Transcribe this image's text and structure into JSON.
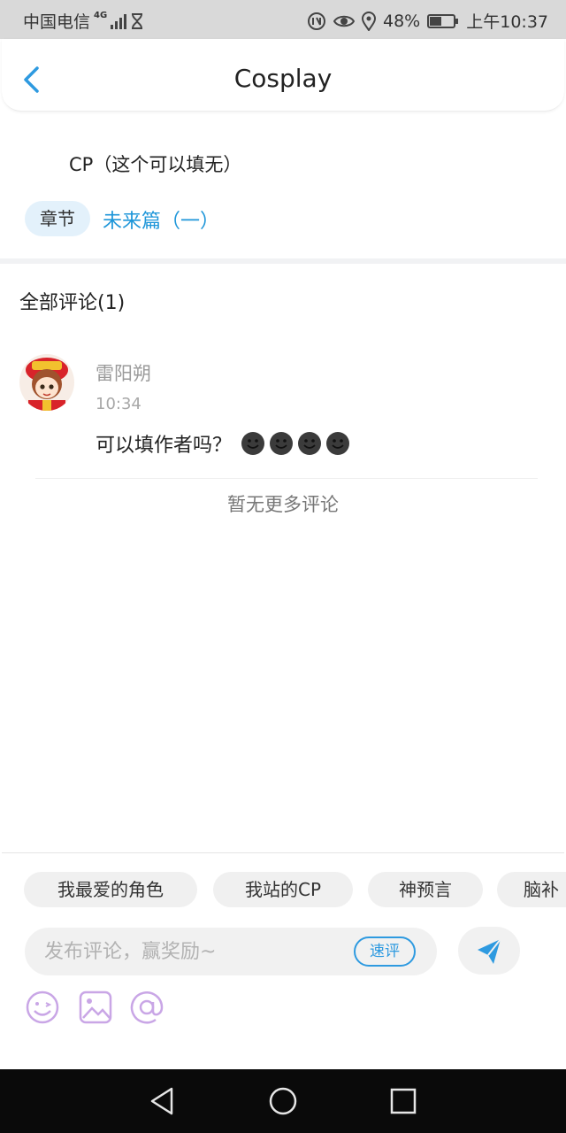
{
  "status_bar": {
    "carrier": "中国电信",
    "network": "4G",
    "battery": "48%",
    "time": "上午10:37"
  },
  "header": {
    "title": "Cosplay"
  },
  "post": {
    "cp_text": "CP（这个可以填无）",
    "chapter_tag": "章节",
    "chapter_name": "未来篇（一）"
  },
  "comments": {
    "title": "全部评论(1)",
    "items": [
      {
        "user": "雷阳朔",
        "time": "10:34",
        "text": "可以填作者吗？",
        "emoji_count": 4
      }
    ],
    "no_more": "暂无更多评论"
  },
  "compose": {
    "chips": [
      "我最爱的角色",
      "我站的CP",
      "神预言",
      "脑补"
    ],
    "placeholder": "发布评论，赢奖励~",
    "quick_label": "速评"
  },
  "colors": {
    "accent": "#1e96d9",
    "tool_icon": "#c9a6e6"
  }
}
